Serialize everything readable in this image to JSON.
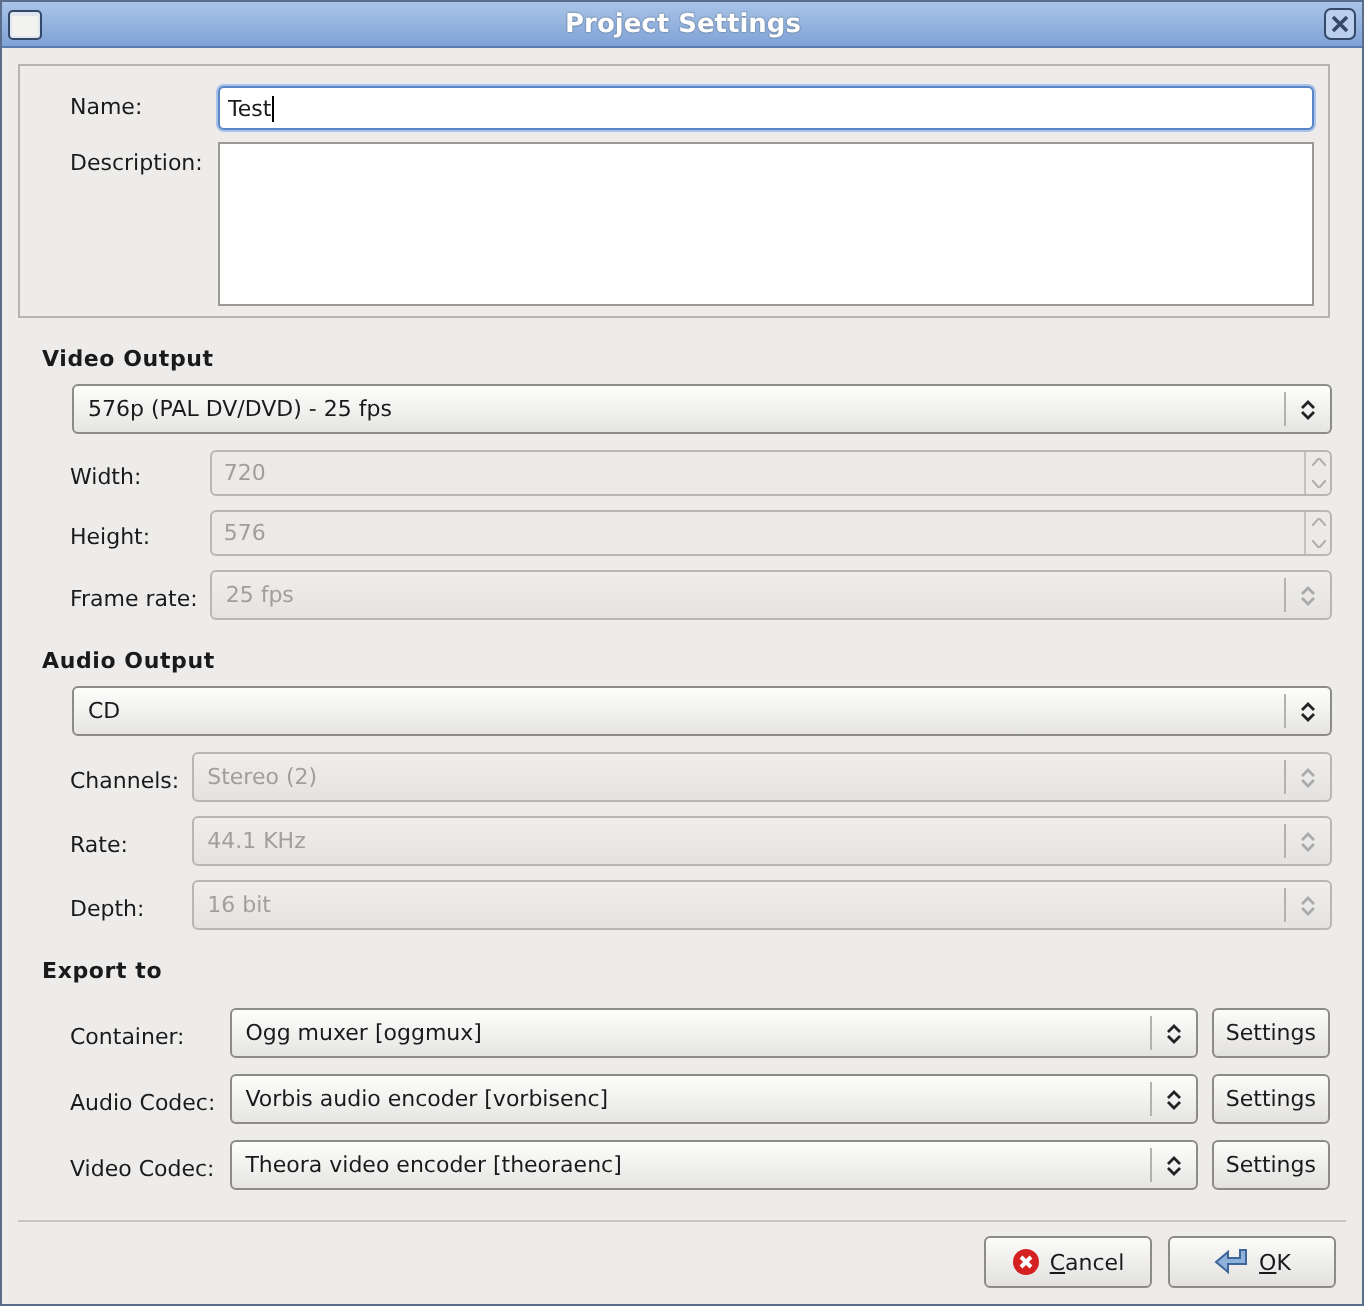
{
  "window": {
    "title": "Project Settings"
  },
  "project": {
    "name_label": "Name:",
    "name_value": "Test",
    "name_focused": true,
    "description_label": "Description:"
  },
  "sections": [
    {
      "heading": "Video Output",
      "preset": {
        "value": "576p (PAL DV/DVD) - 25 fps",
        "disabled": false
      },
      "rows": [
        {
          "label": "Width:",
          "kind": "spin",
          "value": "720",
          "disabled": true
        },
        {
          "label": "Height:",
          "kind": "spin",
          "value": "576",
          "disabled": true
        },
        {
          "label": "Frame rate:",
          "kind": "combo",
          "value": "25 fps",
          "disabled": true
        }
      ]
    },
    {
      "heading": "Audio Output",
      "preset": {
        "value": "CD",
        "disabled": false
      },
      "rows": [
        {
          "label": "Channels:",
          "kind": "combo",
          "value": "Stereo (2)",
          "disabled": true
        },
        {
          "label": "Rate:",
          "kind": "combo",
          "value": "44.1 KHz",
          "disabled": true
        },
        {
          "label": "Depth:",
          "kind": "combo",
          "value": "16 bit",
          "disabled": true
        }
      ]
    }
  ],
  "export": {
    "heading": "Export to",
    "rows": [
      {
        "label": "Container:",
        "value": "Ogg muxer [oggmux]",
        "button": "Settings"
      },
      {
        "label": "Audio Codec:",
        "value": "Vorbis audio encoder [vorbisenc]",
        "button": "Settings"
      },
      {
        "label": "Video Codec:",
        "value": "Theora video encoder [theoraenc]",
        "button": "Settings"
      }
    ]
  },
  "buttons": [
    {
      "kind": "cancel",
      "label": "Cancel"
    },
    {
      "kind": "ok",
      "label": "OK"
    }
  ]
}
